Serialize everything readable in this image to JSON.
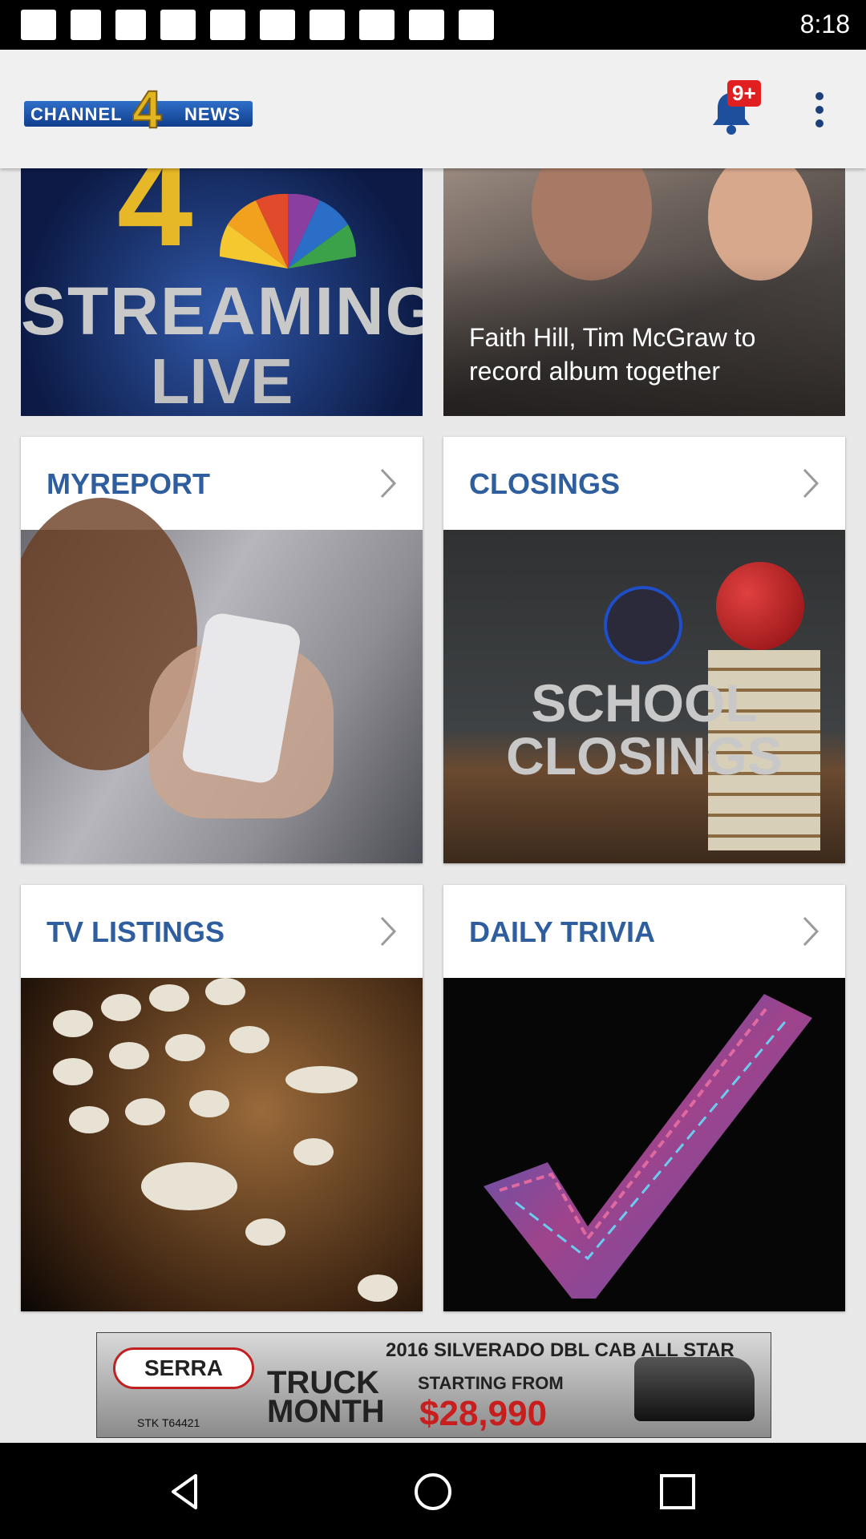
{
  "status_bar": {
    "time": "8:18"
  },
  "app_bar": {
    "logo": {
      "left": "CHANNEL",
      "number": "4",
      "right": "NEWS"
    },
    "notification_badge": "9+",
    "menu_icon": "more-vert-icon"
  },
  "hero": {
    "stream": {
      "number": "4",
      "line1": "STREAMING",
      "line2": "LIVE"
    },
    "news": {
      "headline": "Faith Hill, Tim McGraw to record album together"
    }
  },
  "cards": [
    {
      "label": "MYREPORT"
    },
    {
      "label": "CLOSINGS",
      "image_text": [
        "SCHOOL",
        "CLOSINGS"
      ]
    },
    {
      "label": "TV LISTINGS"
    },
    {
      "label": "DAILY TRIVIA"
    }
  ],
  "ad": {
    "brand": "SERRA",
    "line1": "2016 SILVERADO DBL CAB ALL STAR",
    "headline1": "TRUCK",
    "headline2": "MONTH",
    "starting": "STARTING FROM",
    "price": "$28,990",
    "stock": "STK T64421"
  },
  "nav_bar": {
    "back": "back-icon",
    "home": "home-icon",
    "recents": "recents-icon"
  },
  "colors": {
    "accent": "#2e5e9e",
    "badge": "#e02020",
    "appbar": "#f0f0f0"
  }
}
